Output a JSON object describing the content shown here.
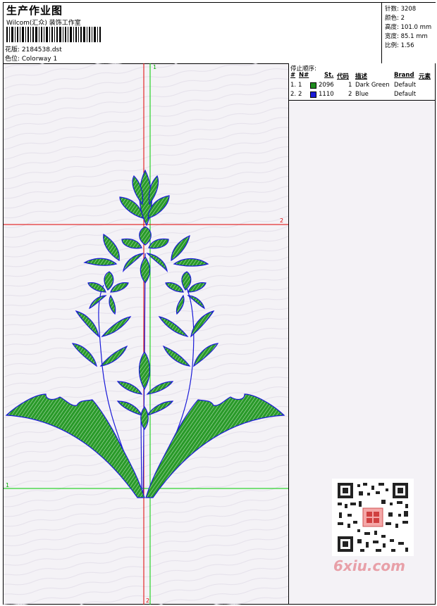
{
  "header": {
    "title": "生产作业图",
    "company": "Wilcom(汇众) 装饰工作室",
    "pattern_label": "花版: 2184538.dst",
    "colorway_label": "色位: Colorway 1"
  },
  "stats": {
    "stitches": "针数: 3208",
    "colors": "颜色: 2",
    "height": "高度: 101.0 mm",
    "width": "宽度: 85.1 mm",
    "ratio": "比例: 1.56"
  },
  "stop_sequence": {
    "title": "停止顺序:",
    "columns": [
      "#",
      "N#",
      "St.",
      "代码",
      "描述",
      "Brand",
      "元素"
    ],
    "rows": [
      {
        "idx": "1.",
        "n": "1",
        "swatch": "#1e8c1e",
        "st": "2096",
        "code": "1",
        "desc": "Dark Green",
        "brand": "Default"
      },
      {
        "idx": "2.",
        "n": "2",
        "swatch": "#1a1ad8",
        "st": "1110",
        "code": "2",
        "desc": "Blue",
        "brand": "Default"
      }
    ]
  },
  "guides": {
    "v_green_top": "1",
    "h_red_right": "2",
    "h_green_left": "1",
    "v_red_bottom": "2"
  },
  "watermark": "6xiu.com",
  "colors": {
    "green": "#1e8c1e",
    "blue": "#1a1ad8",
    "guide_red": "#e00000",
    "guide_green": "#00cc00"
  }
}
